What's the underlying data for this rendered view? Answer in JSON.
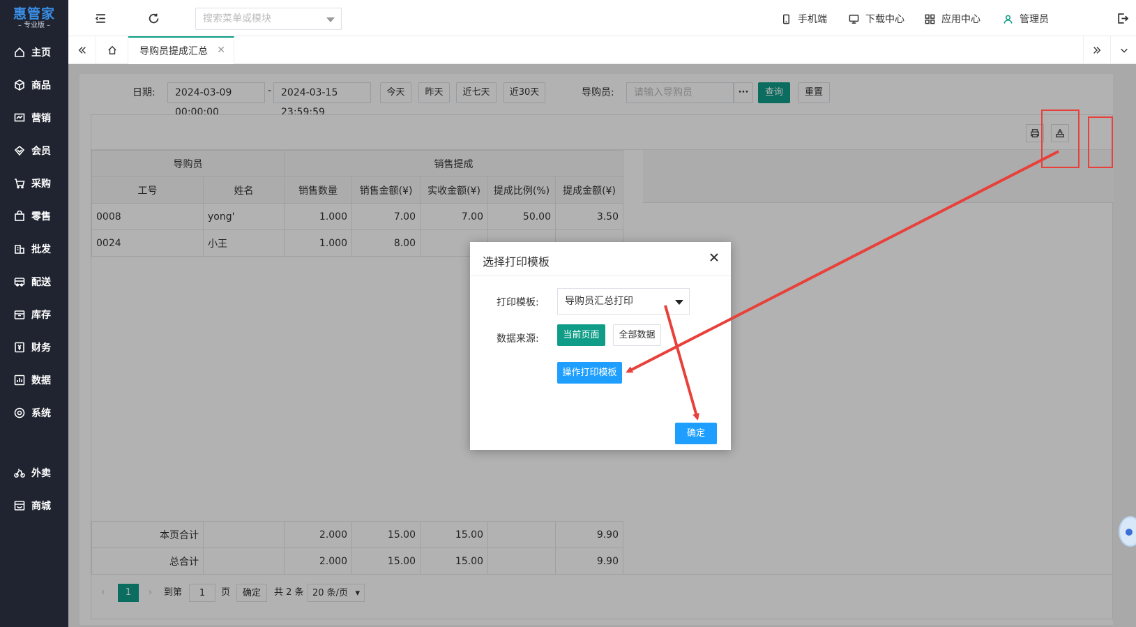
{
  "brand": {
    "name": "惠管家",
    "edition": "专业版"
  },
  "sidebar": {
    "items": [
      {
        "label": "主页",
        "icon": "home-icon"
      },
      {
        "label": "商品",
        "icon": "cube-icon"
      },
      {
        "label": "营销",
        "icon": "chart-icon"
      },
      {
        "label": "会员",
        "icon": "diamond-icon"
      },
      {
        "label": "采购",
        "icon": "cart-icon"
      },
      {
        "label": "零售",
        "icon": "bag-icon"
      },
      {
        "label": "批发",
        "icon": "building-icon"
      },
      {
        "label": "配送",
        "icon": "truck-icon"
      },
      {
        "label": "库存",
        "icon": "box-icon"
      },
      {
        "label": "财务",
        "icon": "finance-icon"
      },
      {
        "label": "数据",
        "icon": "data-icon"
      },
      {
        "label": "系统",
        "icon": "settings-icon"
      },
      {
        "label": "外卖",
        "icon": "bike-icon"
      },
      {
        "label": "商城",
        "icon": "store-icon"
      }
    ]
  },
  "header": {
    "search_placeholder": "搜索菜单或模块",
    "links": {
      "mobile": "手机端",
      "download": "下载中心",
      "apps": "应用中心",
      "user": "管理员"
    }
  },
  "tabs": {
    "active": "导购员提成汇总"
  },
  "filters": {
    "date_label": "日期:",
    "start": "2024-03-09 00:00:00",
    "separator": "-",
    "end": "2024-03-15 23:59:59",
    "quick": [
      "今天",
      "昨天",
      "近七天",
      "近30天"
    ],
    "guide_label": "导购员:",
    "guide_placeholder": "请输入导购员",
    "more": "···",
    "query": "查询",
    "reset": "重置"
  },
  "table": {
    "group_headers": [
      "导购员",
      "销售提成"
    ],
    "columns": [
      "工号",
      "姓名",
      "销售数量",
      "销售金额(¥)",
      "实收金额(¥)",
      "提成比例(%)",
      "提成金额(¥)"
    ],
    "rows": [
      [
        "0008",
        "yong'",
        "1.000",
        "7.00",
        "7.00",
        "50.00",
        "3.50"
      ],
      [
        "0024",
        "小王",
        "1.000",
        "8.00",
        "",
        "",
        ""
      ]
    ],
    "footer": [
      {
        "label": "本页合计",
        "qty": "2.000",
        "sales": "15.00",
        "received": "15.00",
        "commission": "9.90"
      },
      {
        "label": "总合计",
        "qty": "2.000",
        "sales": "15.00",
        "received": "15.00",
        "commission": "9.90"
      }
    ]
  },
  "pager": {
    "current": "1",
    "goto_label": "到第",
    "goto_value": "1",
    "page_unit": "页",
    "confirm": "确定",
    "total": "共 2 条",
    "page_size": "20 条/页"
  },
  "modal": {
    "title": "选择打印模板",
    "template_label": "打印模板:",
    "template_value": "导购员汇总打印",
    "source_label": "数据来源:",
    "source_current": "当前页面",
    "source_all": "全部数据",
    "operate_button": "操作打印模板",
    "confirm_button": "确定"
  },
  "colors": {
    "sidebar": "#1f2430",
    "accent": "#0f9d88",
    "blue": "#1e9fff",
    "annotation": "#e8403a"
  }
}
